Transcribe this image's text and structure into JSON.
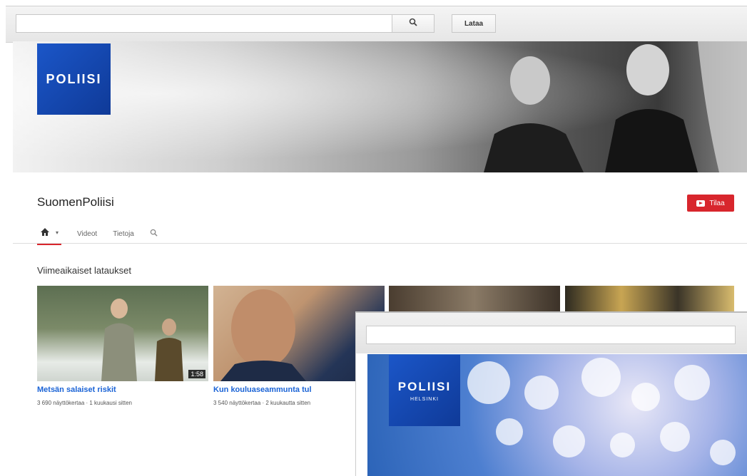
{
  "header": {
    "search_placeholder": "",
    "search_icon": "search-icon",
    "upload_label": "Lataa"
  },
  "channel": {
    "logo_text": "POLIISI",
    "name": "SuomenPoliisi",
    "subscribe_label": "Tilaa",
    "tabs": [
      {
        "label": "Videot"
      },
      {
        "label": "Tietoja"
      }
    ]
  },
  "uploads": {
    "title": "Viimeaikaiset lataukset",
    "videos": [
      {
        "title": "Metsän salaiset riskit",
        "meta": "3 690 näyttökertaa · 1 kuukausi sitten",
        "duration": "1:58"
      },
      {
        "title": "Kun kouluaseammunta tul",
        "meta": "3 540 näyttökertaa · 2 kuukautta sitten",
        "duration": ""
      }
    ]
  },
  "overlay": {
    "search_placeholder": "",
    "logo_text": "POLIISI",
    "logo_subtext": "HELSINKI"
  },
  "colors": {
    "accent": "#d8262d",
    "link": "#1a63d6",
    "logo_blue": "#1b56c8"
  }
}
